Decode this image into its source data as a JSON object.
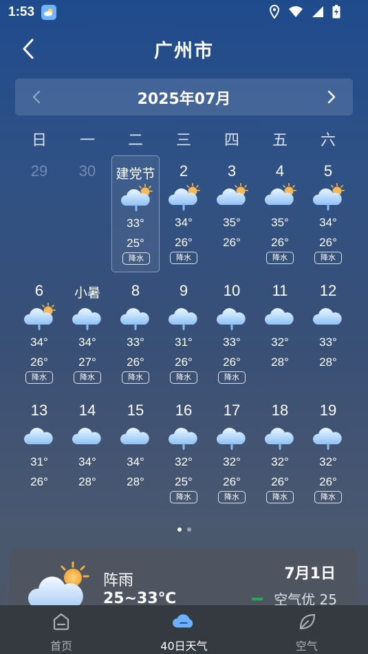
{
  "status_bar": {
    "time": "1:53"
  },
  "header": {
    "city": "广州市"
  },
  "month_nav": {
    "label": "2025年07月"
  },
  "weekdays": [
    "日",
    "一",
    "二",
    "三",
    "四",
    "五",
    "六"
  ],
  "rain_label": "降水",
  "calendar": [
    [
      {
        "day": "29",
        "muted": true
      },
      {
        "day": "30",
        "muted": true
      },
      {
        "day": "建党节",
        "festival": true,
        "selected": true,
        "icon": "cloud-sun-rain-icon",
        "high": "33°",
        "low": "25°",
        "rain": true
      },
      {
        "day": "2",
        "icon": "cloud-sun-rain-icon",
        "high": "34°",
        "low": "26°",
        "rain": true
      },
      {
        "day": "3",
        "icon": "cloud-sun-icon",
        "high": "35°",
        "low": "26°",
        "rain": false
      },
      {
        "day": "4",
        "icon": "cloud-sun-icon",
        "high": "35°",
        "low": "26°",
        "rain": true
      },
      {
        "day": "5",
        "icon": "cloud-sun-rain-icon",
        "high": "34°",
        "low": "26°",
        "rain": true
      }
    ],
    [
      {
        "day": "6",
        "icon": "cloud-sun-rain-icon",
        "high": "34°",
        "low": "26°",
        "rain": true
      },
      {
        "day": "小暑",
        "festival": true,
        "icon": "cloud-rain-icon",
        "high": "34°",
        "low": "27°",
        "rain": true
      },
      {
        "day": "8",
        "icon": "cloud-rain-icon",
        "high": "33°",
        "low": "26°",
        "rain": true
      },
      {
        "day": "9",
        "icon": "cloud-rain-icon",
        "high": "31°",
        "low": "26°",
        "rain": true
      },
      {
        "day": "10",
        "icon": "cloud-rain-icon",
        "high": "33°",
        "low": "26°",
        "rain": true
      },
      {
        "day": "11",
        "icon": "cloud-icon",
        "high": "32°",
        "low": "28°",
        "rain": false
      },
      {
        "day": "12",
        "icon": "cloud-icon",
        "high": "33°",
        "low": "28°",
        "rain": false
      }
    ],
    [
      {
        "day": "13",
        "icon": "cloud-icon",
        "high": "31°",
        "low": "26°",
        "rain": false
      },
      {
        "day": "14",
        "icon": "cloud-icon",
        "high": "34°",
        "low": "28°",
        "rain": false
      },
      {
        "day": "15",
        "icon": "cloud-icon",
        "high": "34°",
        "low": "28°",
        "rain": false
      },
      {
        "day": "16",
        "icon": "cloud-rain-icon",
        "high": "32°",
        "low": "25°",
        "rain": true
      },
      {
        "day": "17",
        "icon": "cloud-rain-icon",
        "high": "32°",
        "low": "26°",
        "rain": true
      },
      {
        "day": "18",
        "icon": "cloud-rain-icon",
        "high": "32°",
        "low": "26°",
        "rain": true
      },
      {
        "day": "19",
        "icon": "cloud-rain-icon",
        "high": "32°",
        "low": "26°",
        "rain": true
      }
    ]
  ],
  "detail": {
    "weather": "阵雨",
    "temp_range": "25~33℃",
    "date": "7月1日",
    "air_quality": "空气优 25",
    "air_color": "#1ab04b"
  },
  "bottom_nav": [
    {
      "label": "首页",
      "icon": "home-icon",
      "active": false
    },
    {
      "label": "40日天气",
      "icon": "cloud-icon",
      "active": true
    },
    {
      "label": "空气",
      "icon": "leaf-icon",
      "active": false
    }
  ]
}
